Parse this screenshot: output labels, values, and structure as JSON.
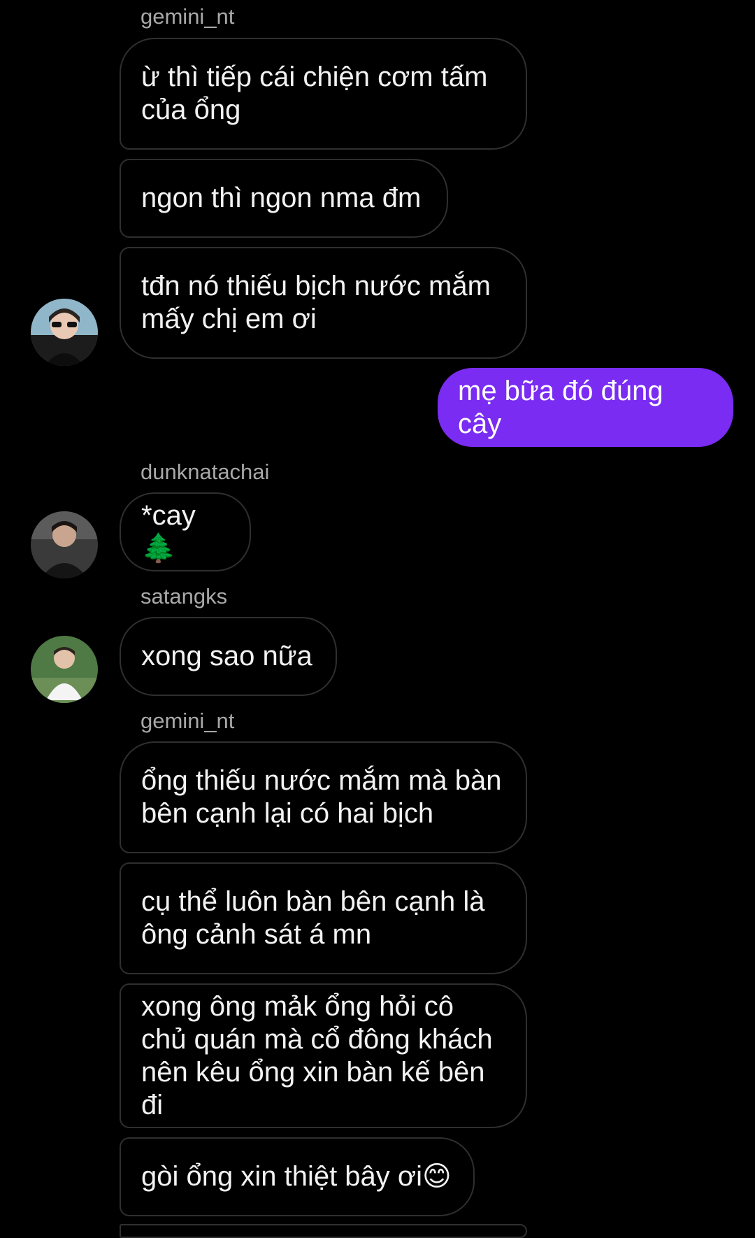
{
  "messages": {
    "g1_sender": "gemini_nt",
    "g1_m1": "ừ thì tiếp cái chiện cơm tấm của ổng",
    "g1_m2": "ngon thì ngon nma đm",
    "g1_m3": "tđn nó thiếu bịch nước mắm mấy chị em ơi",
    "me_m1": "mẹ bữa đó đúng cây",
    "d_sender": "dunknatachai",
    "d_m1": "*cay🌲",
    "s_sender": "satangks",
    "s_m1": "xong sao nữa",
    "g2_sender": "gemini_nt",
    "g2_m1": "ổng thiếu nước mắm mà bàn bên cạnh lại có hai bịch",
    "g2_m2": "cụ thể luôn bàn bên cạnh là ông cảnh sát á mn",
    "g2_m3": "xong ông mảk ổng hỏi cô chủ quán mà cổ đông khách nên kêu ổng xin bàn kế bên đi",
    "g2_m4": "gòi ổng xin thiệt bây ơi😊"
  },
  "colors": {
    "background": "#000000",
    "my_bubble": "#7a2cf2",
    "bubble_border": "#2f2f2f",
    "sender_text": "#a8a8a8"
  }
}
